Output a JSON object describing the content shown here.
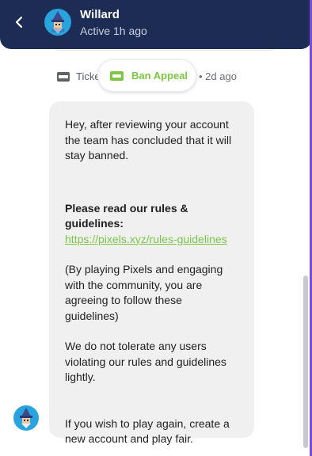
{
  "header": {
    "name": "Willard",
    "status": "Active 1h ago",
    "colors": {
      "background": "#1c2c55",
      "status_text": "#c9d0e0"
    }
  },
  "meta": {
    "ticket_label": "Ticke",
    "time": "• 2d ago"
  },
  "tooltip": {
    "label": "Ban Appeal",
    "accent": "#7cc547"
  },
  "message": {
    "intro": "Hey, after reviewing your account the team has concluded that it will stay banned.",
    "rules_heading": "Please read our rules & guidelines:",
    "link": "https://pixels.xyz/rules-guidelines",
    "agreement": "(By playing Pixels and engaging with the community, you are agreeing to follow these guidelines)",
    "tolerance": "We do not tolerate any users violating our rules and guidelines lightly.",
    "play_again": "If you wish to play again, create a new account and play fair."
  },
  "icons": {
    "back": "chevron-left-icon",
    "ticket": "ticket-icon",
    "avatar": "wizard-avatar"
  }
}
